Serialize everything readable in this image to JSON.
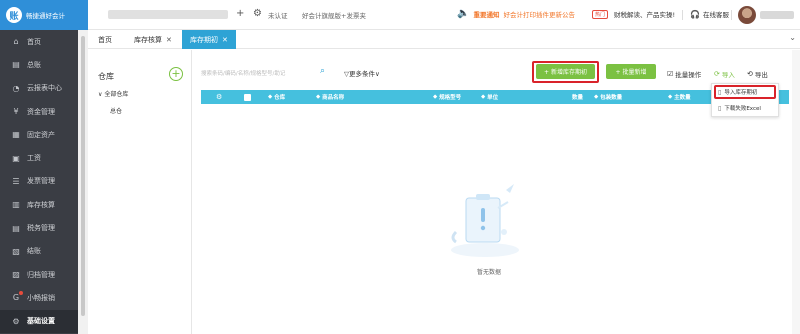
{
  "app": {
    "logo_glyph": "账",
    "logo_text": "畅捷通好会计"
  },
  "topbar": {
    "unverified": "未认证",
    "product": "好会计旗舰版+发票夹",
    "notice_label": "重要通知",
    "notice_text": "好会计打印插件更新公告",
    "hot_badge": "热门",
    "hot_text": "财税解读、产品实操!",
    "service": "在线客服",
    "add_glyph": "+",
    "gear_glyph": "⚙",
    "speaker_glyph": "🔈",
    "headset_glyph": "🎧"
  },
  "sidebar": {
    "items": [
      {
        "icon": "⌂",
        "label": "首页"
      },
      {
        "icon": "▤",
        "label": "总账"
      },
      {
        "icon": "◔",
        "label": "云报表中心"
      },
      {
        "icon": "¥",
        "label": "资金管理"
      },
      {
        "icon": "▦",
        "label": "固定资产"
      },
      {
        "icon": "▣",
        "label": "工资"
      },
      {
        "icon": "☰",
        "label": "发票管理"
      },
      {
        "icon": "▥",
        "label": "库存核算"
      },
      {
        "icon": "▤",
        "label": "税务管理"
      },
      {
        "icon": "▧",
        "label": "结账"
      },
      {
        "icon": "▨",
        "label": "归档管理"
      },
      {
        "icon": "G",
        "label": "小畅报销"
      },
      {
        "icon": "⚙",
        "label": "基础设置"
      }
    ]
  },
  "tabs": [
    {
      "label": "首页"
    },
    {
      "label": "库存核算"
    },
    {
      "label": "库存期初"
    }
  ],
  "left_panel": {
    "title": "仓库",
    "add_glyph": "+",
    "tree_root": "全部仓库",
    "tree_child": "总仓"
  },
  "toolbar": {
    "search_placeholder": "搜索条码/编码/名称/规格型号/助记",
    "more_conditions": "▽更多条件∨",
    "add_opening_button": "+ 新增库存期初",
    "batch_add_button": "+ 批量新增",
    "batch_ops": "批量操作",
    "import": "导入",
    "export": "导出"
  },
  "grid": {
    "columns": [
      "仓库",
      "商品名称",
      "规格型号",
      "单位",
      "数量",
      "包装数量",
      "主数量"
    ]
  },
  "import_menu": {
    "items": [
      "导入库存期初",
      "下载失败Excel"
    ]
  },
  "empty": {
    "text": "暂无数据"
  },
  "colors": {
    "brand_blue": "#2f8fd8",
    "tab_active": "#2ea3d5",
    "grid_header": "#45c0de",
    "green_button": "#7bc142",
    "highlight_red": "#d9232a",
    "notice_orange": "#f2772b"
  }
}
